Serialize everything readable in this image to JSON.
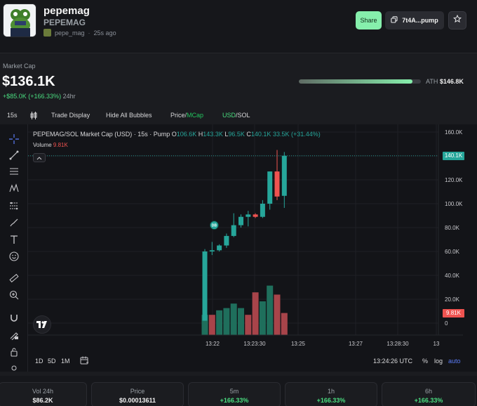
{
  "header": {
    "token_name": "pepemag",
    "token_symbol": "PEPEMAG",
    "creator": "pepe_mag",
    "created_ago": "25s ago",
    "share_label": "Share",
    "contract_label": "7t4A...pump"
  },
  "market": {
    "label": "Market Cap",
    "value": "$136.1K",
    "change": "+$85.0K (+166.33%)",
    "change_period": "24hr",
    "ath_label": "ATH",
    "ath_value": "$146.8K",
    "ath_progress": 0.93
  },
  "toolbar": {
    "interval": "15s",
    "trade_display": "Trade Display",
    "hide_bubbles": "Hide All Bubbles",
    "price_label": "Price",
    "mcap_label": "MCap",
    "usd_label": "USD",
    "sol_label": "SOL",
    "sep": "/"
  },
  "chart_header": {
    "title": "PEPEMAG/SOL Market Cap (USD) · 15s · Pump",
    "o_label": "O",
    "o_value": "106.6K",
    "h_label": "H",
    "h_value": "143.3K",
    "l_label": "L",
    "l_value": "96.5K",
    "c_label": "C",
    "c_value": "140.1K",
    "change": "33.5K (+31.44%)",
    "volume_label": "Volume",
    "volume_value": "9.81K",
    "last_price_tag": "140.1K",
    "volume_tag": "9.81K",
    "bubble_label": "DB"
  },
  "chart_data": {
    "type": "candlestick",
    "y_unit": "K USD",
    "ylim": [
      0,
      160
    ],
    "y_ticks": [
      "160.0K",
      "140.0K",
      "120.0K",
      "100.0K",
      "80.0K",
      "60.0K",
      "40.0K",
      "20.0K",
      "0"
    ],
    "y_tick_values": [
      160,
      140,
      120,
      100,
      80,
      60,
      40,
      20,
      0
    ],
    "x_ticks": [
      "13:22",
      "13:23:30",
      "13:25",
      "13:27",
      "13:28:30",
      "13"
    ],
    "candles": [
      {
        "o": 2,
        "h": 62,
        "l": 2,
        "c": 60
      },
      {
        "o": 60,
        "h": 68,
        "l": 57,
        "c": 61
      },
      {
        "o": 61,
        "h": 66,
        "l": 60,
        "c": 65
      },
      {
        "o": 65,
        "h": 75,
        "l": 63,
        "c": 73
      },
      {
        "o": 73,
        "h": 92,
        "l": 72,
        "c": 82
      },
      {
        "o": 82,
        "h": 91,
        "l": 80,
        "c": 89
      },
      {
        "o": 89,
        "h": 94,
        "l": 81,
        "c": 91
      },
      {
        "o": 91,
        "h": 92,
        "l": 88,
        "c": 89
      },
      {
        "o": 89,
        "h": 103,
        "l": 88,
        "c": 100
      },
      {
        "o": 100,
        "h": 115,
        "l": 95,
        "c": 127
      },
      {
        "o": 127,
        "h": 145,
        "l": 103,
        "c": 106
      },
      {
        "o": 106.6,
        "h": 143.3,
        "l": 96.5,
        "c": 140.1
      }
    ],
    "volumes": [
      {
        "v": 9,
        "dir": "up"
      },
      {
        "v": 9,
        "dir": "down"
      },
      {
        "v": 11,
        "dir": "up"
      },
      {
        "v": 12,
        "dir": "up"
      },
      {
        "v": 14,
        "dir": "up"
      },
      {
        "v": 12,
        "dir": "up"
      },
      {
        "v": 9,
        "dir": "down"
      },
      {
        "v": 19,
        "dir": "down"
      },
      {
        "v": 15,
        "dir": "up"
      },
      {
        "v": 22,
        "dir": "up"
      },
      {
        "v": 18,
        "dir": "down"
      },
      {
        "v": 9.81,
        "dir": "down"
      }
    ],
    "colors": {
      "up": "#26a69a",
      "down": "#ef5350",
      "vol_up": "#1f6f5c",
      "vol_down": "#a8444a"
    }
  },
  "chart_footer": {
    "ranges": [
      "1D",
      "5D",
      "1M"
    ],
    "time": "13:24:26 UTC",
    "percent": "%",
    "log": "log",
    "auto": "auto"
  },
  "stats": [
    {
      "label": "Vol 24h",
      "value": "$86.2K",
      "up": false
    },
    {
      "label": "Price",
      "value": "$0.00013611",
      "up": false
    },
    {
      "label": "5m",
      "value": "+166.33%",
      "up": true
    },
    {
      "label": "1h",
      "value": "+166.33%",
      "up": true
    },
    {
      "label": "6h",
      "value": "+166.33%",
      "up": true
    }
  ],
  "theme": {
    "accent": "#86efac",
    "up": "#4ade80",
    "down": "#ef5350"
  }
}
